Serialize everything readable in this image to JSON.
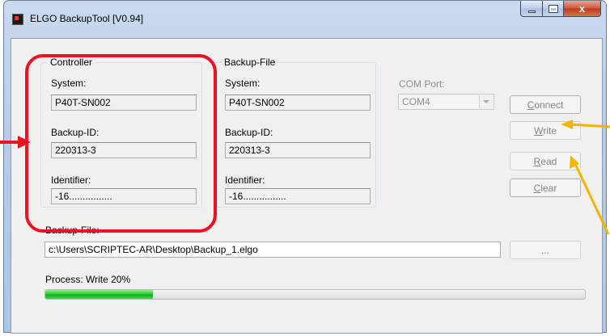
{
  "window": {
    "title": "ELGO BackupTool [V0.94]",
    "close_glyph": "x",
    "icons": [
      "app-icon",
      "minimize-icon",
      "maximize-icon",
      "close-icon"
    ]
  },
  "controller": {
    "group_title": "Controller",
    "system_label": "System:",
    "system_value": "P40T-SN002",
    "backup_id_label": "Backup-ID:",
    "backup_id_value": "220313-3",
    "identifier_label": "Identifier:",
    "identifier_value": "-16................"
  },
  "backup_file_group": {
    "group_title": "Backup-File",
    "system_label": "System:",
    "system_value": "P40T-SN002",
    "backup_id_label": "Backup-ID:",
    "backup_id_value": "220313-3",
    "identifier_label": "Identifier:",
    "identifier_value": "-16................"
  },
  "com_port": {
    "label": "COM Port:",
    "selected": "COM4"
  },
  "buttons": {
    "connect": {
      "mnemonic": "C",
      "rest": "onnect"
    },
    "write": {
      "mnemonic": "W",
      "rest": "rite"
    },
    "read": {
      "mnemonic": "R",
      "rest": "ead"
    },
    "clear": {
      "mnemonic": "C",
      "rest": "lear"
    },
    "browse": "..."
  },
  "backup_path": {
    "label": "Backup-File:",
    "value": "c:\\Users\\SCRIPTEC-AR\\Desktop\\Backup_1.elgo"
  },
  "process": {
    "label": "Process: Write 20%",
    "progress_fraction": 0.2
  },
  "colors": {
    "highlight": "#ee1122",
    "arrow_left": "#ee1122",
    "arrow_right": "#f5b400",
    "progress": "#06b025"
  }
}
